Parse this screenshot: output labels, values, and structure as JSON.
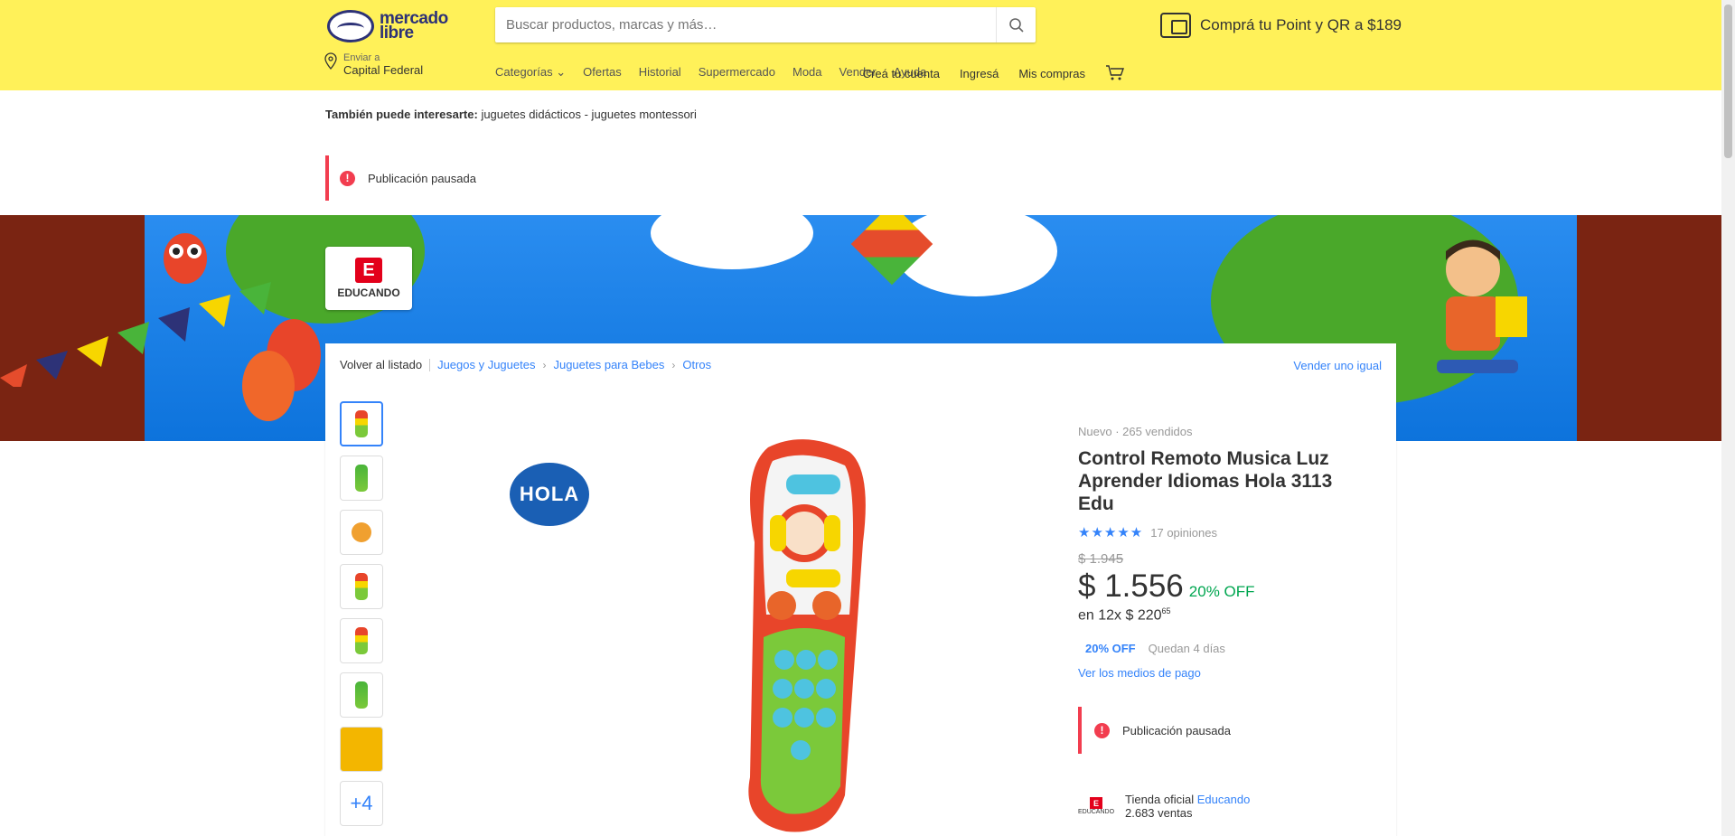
{
  "header": {
    "logo_line1": "mercado",
    "logo_line2": "libre",
    "search_placeholder": "Buscar productos, marcas y más…",
    "promo_text": "Comprá tu Point y QR a $189",
    "location_label": "Enviar a",
    "location_value": "Capital Federal",
    "nav": [
      "Categorías ⌄",
      "Ofertas",
      "Historial",
      "Supermercado",
      "Moda",
      "Vender",
      "Ayuda"
    ],
    "user_actions": [
      "Creá tu cuenta",
      "Ingresá",
      "Mis compras"
    ]
  },
  "interest": {
    "label": "También puede interesarte:",
    "links": "juguetes didácticos - juguetes montessori"
  },
  "notice": {
    "text": "Publicación pausada",
    "icon": "!"
  },
  "brand": {
    "letter": "E",
    "name": "EDUCANDO"
  },
  "breadcrumb": {
    "back": "Volver al listado",
    "items": [
      "Juegos y Juguetes",
      "Juguetes para Bebes",
      "Otros"
    ],
    "sell_same": "Vender uno igual"
  },
  "gallery": {
    "more_label": "+4",
    "hola_logo": "HOLA"
  },
  "product": {
    "condition": "Nuevo · 265 vendidos",
    "title": "Control Remoto Musica Luz Aprender Idiomas Hola 3113 Edu",
    "stars": "★★★★★",
    "reviews": "17 opiniones",
    "old_price": "$ 1.945",
    "price": "$ 1.556",
    "discount": "20% OFF",
    "installments": "en 12x $ 220",
    "installments_cents": "65",
    "promo_badge": "20% OFF",
    "promo_days": "Quedan 4 días",
    "payment_link": "Ver los medios de pago",
    "paused": "Publicación pausada",
    "store_label": "Tienda oficial",
    "store_name": "Educando",
    "store_sales": "2.683 ventas",
    "store_logo_letter": "E",
    "store_logo_name": "EDUCANDO"
  },
  "colors": {
    "header_bg": "#fff159",
    "link": "#3483fa",
    "alert": "#f23d4f",
    "discount": "#00a650"
  }
}
